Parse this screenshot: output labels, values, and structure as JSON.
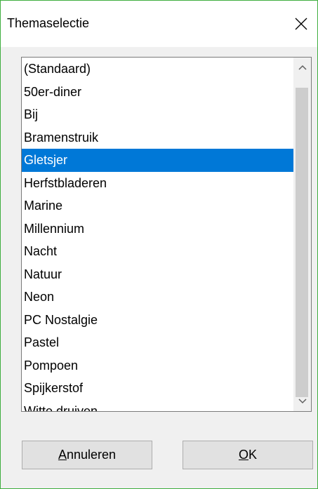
{
  "dialog": {
    "title": "Themaselectie",
    "close_icon": "close-icon"
  },
  "theme_list": {
    "items": [
      {
        "label": "(Standaard)",
        "selected": false
      },
      {
        "label": "50er-diner",
        "selected": false
      },
      {
        "label": "Bij",
        "selected": false
      },
      {
        "label": "Bramenstruik",
        "selected": false
      },
      {
        "label": "Gletsjer",
        "selected": true
      },
      {
        "label": "Herfstbladeren",
        "selected": false
      },
      {
        "label": "Marine",
        "selected": false
      },
      {
        "label": "Millennium",
        "selected": false
      },
      {
        "label": "Nacht",
        "selected": false
      },
      {
        "label": "Natuur",
        "selected": false
      },
      {
        "label": "Neon",
        "selected": false
      },
      {
        "label": "PC Nostalgie",
        "selected": false
      },
      {
        "label": "Pastel",
        "selected": false
      },
      {
        "label": "Pompoen",
        "selected": false
      },
      {
        "label": "Spijkerstof",
        "selected": false
      },
      {
        "label": "Witte druiven",
        "selected": false
      }
    ],
    "scroll_up_icon": "chevron-up-icon",
    "scroll_down_icon": "chevron-down-icon"
  },
  "buttons": {
    "cancel": {
      "mnemonic": "A",
      "rest": "nnuleren"
    },
    "ok": {
      "mnemonic": "O",
      "rest": "K"
    }
  },
  "colors": {
    "selection": "#0078d7",
    "window_border": "#3fae3f",
    "dialog_bg": "#f0f0f0"
  }
}
